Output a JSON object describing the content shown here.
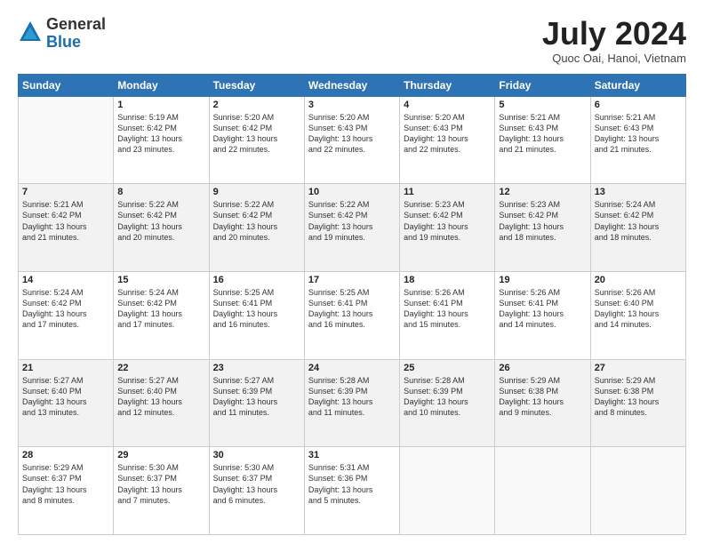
{
  "logo": {
    "general": "General",
    "blue": "Blue",
    "icon_color": "#1a6fad"
  },
  "header": {
    "month": "July 2024",
    "location": "Quoc Oai, Hanoi, Vietnam"
  },
  "weekdays": [
    "Sunday",
    "Monday",
    "Tuesday",
    "Wednesday",
    "Thursday",
    "Friday",
    "Saturday"
  ],
  "weeks": [
    [
      {
        "day": "",
        "sunrise": "",
        "sunset": "",
        "daylight": ""
      },
      {
        "day": "1",
        "sunrise": "Sunrise: 5:19 AM",
        "sunset": "Sunset: 6:42 PM",
        "daylight": "Daylight: 13 hours and 23 minutes."
      },
      {
        "day": "2",
        "sunrise": "Sunrise: 5:20 AM",
        "sunset": "Sunset: 6:42 PM",
        "daylight": "Daylight: 13 hours and 22 minutes."
      },
      {
        "day": "3",
        "sunrise": "Sunrise: 5:20 AM",
        "sunset": "Sunset: 6:43 PM",
        "daylight": "Daylight: 13 hours and 22 minutes."
      },
      {
        "day": "4",
        "sunrise": "Sunrise: 5:20 AM",
        "sunset": "Sunset: 6:43 PM",
        "daylight": "Daylight: 13 hours and 22 minutes."
      },
      {
        "day": "5",
        "sunrise": "Sunrise: 5:21 AM",
        "sunset": "Sunset: 6:43 PM",
        "daylight": "Daylight: 13 hours and 21 minutes."
      },
      {
        "day": "6",
        "sunrise": "Sunrise: 5:21 AM",
        "sunset": "Sunset: 6:43 PM",
        "daylight": "Daylight: 13 hours and 21 minutes."
      }
    ],
    [
      {
        "day": "7",
        "sunrise": "Sunrise: 5:21 AM",
        "sunset": "Sunset: 6:42 PM",
        "daylight": "Daylight: 13 hours and 21 minutes."
      },
      {
        "day": "8",
        "sunrise": "Sunrise: 5:22 AM",
        "sunset": "Sunset: 6:42 PM",
        "daylight": "Daylight: 13 hours and 20 minutes."
      },
      {
        "day": "9",
        "sunrise": "Sunrise: 5:22 AM",
        "sunset": "Sunset: 6:42 PM",
        "daylight": "Daylight: 13 hours and 20 minutes."
      },
      {
        "day": "10",
        "sunrise": "Sunrise: 5:22 AM",
        "sunset": "Sunset: 6:42 PM",
        "daylight": "Daylight: 13 hours and 19 minutes."
      },
      {
        "day": "11",
        "sunrise": "Sunrise: 5:23 AM",
        "sunset": "Sunset: 6:42 PM",
        "daylight": "Daylight: 13 hours and 19 minutes."
      },
      {
        "day": "12",
        "sunrise": "Sunrise: 5:23 AM",
        "sunset": "Sunset: 6:42 PM",
        "daylight": "Daylight: 13 hours and 18 minutes."
      },
      {
        "day": "13",
        "sunrise": "Sunrise: 5:24 AM",
        "sunset": "Sunset: 6:42 PM",
        "daylight": "Daylight: 13 hours and 18 minutes."
      }
    ],
    [
      {
        "day": "14",
        "sunrise": "Sunrise: 5:24 AM",
        "sunset": "Sunset: 6:42 PM",
        "daylight": "Daylight: 13 hours and 17 minutes."
      },
      {
        "day": "15",
        "sunrise": "Sunrise: 5:24 AM",
        "sunset": "Sunset: 6:42 PM",
        "daylight": "Daylight: 13 hours and 17 minutes."
      },
      {
        "day": "16",
        "sunrise": "Sunrise: 5:25 AM",
        "sunset": "Sunset: 6:41 PM",
        "daylight": "Daylight: 13 hours and 16 minutes."
      },
      {
        "day": "17",
        "sunrise": "Sunrise: 5:25 AM",
        "sunset": "Sunset: 6:41 PM",
        "daylight": "Daylight: 13 hours and 16 minutes."
      },
      {
        "day": "18",
        "sunrise": "Sunrise: 5:26 AM",
        "sunset": "Sunset: 6:41 PM",
        "daylight": "Daylight: 13 hours and 15 minutes."
      },
      {
        "day": "19",
        "sunrise": "Sunrise: 5:26 AM",
        "sunset": "Sunset: 6:41 PM",
        "daylight": "Daylight: 13 hours and 14 minutes."
      },
      {
        "day": "20",
        "sunrise": "Sunrise: 5:26 AM",
        "sunset": "Sunset: 6:40 PM",
        "daylight": "Daylight: 13 hours and 14 minutes."
      }
    ],
    [
      {
        "day": "21",
        "sunrise": "Sunrise: 5:27 AM",
        "sunset": "Sunset: 6:40 PM",
        "daylight": "Daylight: 13 hours and 13 minutes."
      },
      {
        "day": "22",
        "sunrise": "Sunrise: 5:27 AM",
        "sunset": "Sunset: 6:40 PM",
        "daylight": "Daylight: 13 hours and 12 minutes."
      },
      {
        "day": "23",
        "sunrise": "Sunrise: 5:27 AM",
        "sunset": "Sunset: 6:39 PM",
        "daylight": "Daylight: 13 hours and 11 minutes."
      },
      {
        "day": "24",
        "sunrise": "Sunrise: 5:28 AM",
        "sunset": "Sunset: 6:39 PM",
        "daylight": "Daylight: 13 hours and 11 minutes."
      },
      {
        "day": "25",
        "sunrise": "Sunrise: 5:28 AM",
        "sunset": "Sunset: 6:39 PM",
        "daylight": "Daylight: 13 hours and 10 minutes."
      },
      {
        "day": "26",
        "sunrise": "Sunrise: 5:29 AM",
        "sunset": "Sunset: 6:38 PM",
        "daylight": "Daylight: 13 hours and 9 minutes."
      },
      {
        "day": "27",
        "sunrise": "Sunrise: 5:29 AM",
        "sunset": "Sunset: 6:38 PM",
        "daylight": "Daylight: 13 hours and 8 minutes."
      }
    ],
    [
      {
        "day": "28",
        "sunrise": "Sunrise: 5:29 AM",
        "sunset": "Sunset: 6:37 PM",
        "daylight": "Daylight: 13 hours and 8 minutes."
      },
      {
        "day": "29",
        "sunrise": "Sunrise: 5:30 AM",
        "sunset": "Sunset: 6:37 PM",
        "daylight": "Daylight: 13 hours and 7 minutes."
      },
      {
        "day": "30",
        "sunrise": "Sunrise: 5:30 AM",
        "sunset": "Sunset: 6:37 PM",
        "daylight": "Daylight: 13 hours and 6 minutes."
      },
      {
        "day": "31",
        "sunrise": "Sunrise: 5:31 AM",
        "sunset": "Sunset: 6:36 PM",
        "daylight": "Daylight: 13 hours and 5 minutes."
      },
      {
        "day": "",
        "sunrise": "",
        "sunset": "",
        "daylight": ""
      },
      {
        "day": "",
        "sunrise": "",
        "sunset": "",
        "daylight": ""
      },
      {
        "day": "",
        "sunrise": "",
        "sunset": "",
        "daylight": ""
      }
    ]
  ]
}
